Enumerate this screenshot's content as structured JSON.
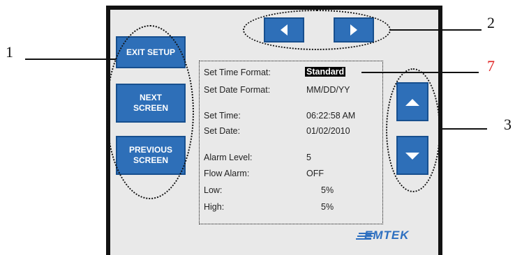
{
  "setup_buttons": {
    "exit_setup": "EXIT SETUP",
    "next_screen": "NEXT\nSCREEN",
    "previous_screen": "PREVIOUS\nSCREEN"
  },
  "nav_arrows": {
    "left_icon": "left-triangle-icon",
    "right_icon": "right-triangle-icon"
  },
  "scroll_arrows": {
    "up_icon": "up-triangle-icon",
    "down_icon": "down-triangle-icon"
  },
  "settings": [
    {
      "label": "Set Time Format:",
      "value": "Standard",
      "selected": true
    },
    {
      "label": "Set Date Format:",
      "value": "MM/DD/YY"
    },
    {
      "label": "Set Time:",
      "value": "06:22:58 AM"
    },
    {
      "label": "Set Date:",
      "value": "01/02/2010"
    },
    {
      "label": "Alarm Level:",
      "value": "5"
    },
    {
      "label": "Flow Alarm:",
      "value": "OFF"
    },
    {
      "label": "Low:",
      "value": "5%"
    },
    {
      "label": "High:",
      "value": "5%"
    }
  ],
  "callouts": {
    "c1": "1",
    "c2": "2",
    "c3": "3",
    "c7": "7"
  },
  "logo": "EMTEK",
  "colors": {
    "button_blue": "#2e6fb8",
    "callout_highlight": "#e02020"
  }
}
